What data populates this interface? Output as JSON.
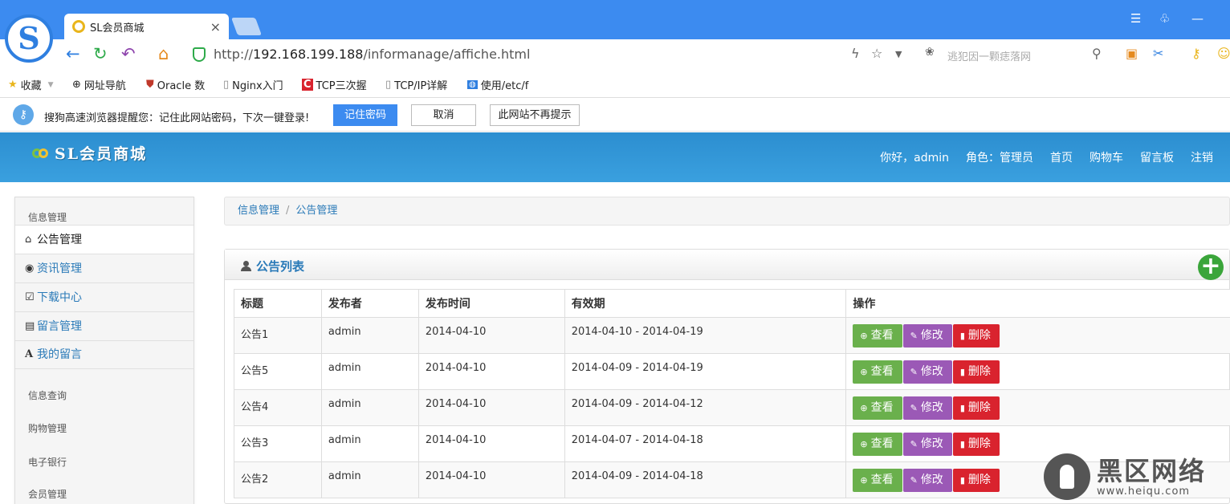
{
  "browser": {
    "logo_letter": "S",
    "tab_title": "SL会员商城",
    "tab_close": "×",
    "url_prefix": "http://",
    "url_host": "192.168.199.188",
    "url_path": "/informanage/affiche.html",
    "search_placeholder": "逃犯因一颗痣落网",
    "bookmarks": [
      {
        "label": "收藏",
        "icon": "star-icon"
      },
      {
        "label": "网址导航",
        "icon": "globe-icon"
      },
      {
        "label": "Oracle 数",
        "icon": "shield-icon"
      },
      {
        "label": "Nginx入门",
        "icon": "page-icon"
      },
      {
        "label": "TCP三次握",
        "icon": "c-icon"
      },
      {
        "label": "TCP/IP详解",
        "icon": "page-icon"
      },
      {
        "label": "使用/etc/f",
        "icon": "app-icon"
      }
    ],
    "password_prompt": {
      "message": "搜狗高速浏览器提醒您：记住此网站密码，下次一键登录!",
      "remember": "记住密码",
      "cancel": "取消",
      "never": "此网站不再提示"
    }
  },
  "site": {
    "brand": "SL会员商城",
    "nav": [
      "你好，admin",
      "角色：管理员",
      "首页",
      "购物车",
      "留言板",
      "注销"
    ]
  },
  "sidebar": {
    "groups": [
      "信息管理",
      "信息查询",
      "购物管理",
      "电子银行",
      "会员管理"
    ],
    "items": [
      {
        "label": "公告管理",
        "icon": "home-icon"
      },
      {
        "label": "资讯管理",
        "icon": "eye-icon"
      },
      {
        "label": "下载中心",
        "icon": "edit-icon"
      },
      {
        "label": "留言管理",
        "icon": "list-icon"
      },
      {
        "label": "我的留言",
        "icon": "font-icon"
      }
    ]
  },
  "breadcrumb": {
    "root": "信息管理",
    "current": "公告管理"
  },
  "panel": {
    "title": "公告列表",
    "columns": [
      "标题",
      "发布者",
      "发布时间",
      "有效期",
      "操作"
    ],
    "rows": [
      {
        "title": "公告1",
        "author": "admin",
        "date": "2014-04-10",
        "valid": "2014-04-10 - 2014-04-19"
      },
      {
        "title": "公告5",
        "author": "admin",
        "date": "2014-04-10",
        "valid": "2014-04-09 - 2014-04-19"
      },
      {
        "title": "公告4",
        "author": "admin",
        "date": "2014-04-10",
        "valid": "2014-04-09 - 2014-04-12"
      },
      {
        "title": "公告3",
        "author": "admin",
        "date": "2014-04-10",
        "valid": "2014-04-07 - 2014-04-18"
      },
      {
        "title": "公告2",
        "author": "admin",
        "date": "2014-04-10",
        "valid": "2014-04-09 - 2014-04-18"
      }
    ],
    "actions": {
      "view": "查看",
      "edit": "修改",
      "delete": "删除"
    }
  },
  "watermark": {
    "cn": "黑区网络",
    "url": "www.heiqu.com"
  },
  "colors": {
    "browser_blue": "#3c8bf0",
    "header_blue": "#2c8ed0",
    "view_green": "#6ab04c",
    "edit_purple": "#9b59b6",
    "delete_red": "#d9232e",
    "link_blue": "#2a7ab8"
  }
}
